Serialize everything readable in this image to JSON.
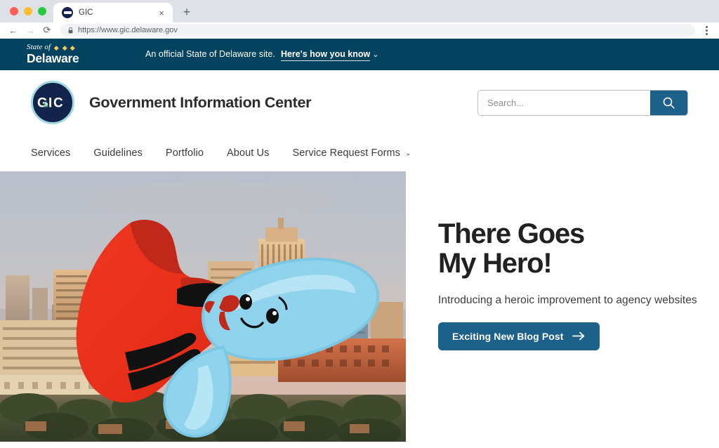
{
  "browser": {
    "tab": {
      "title": "GIC",
      "favicon_icon": "gic-favicon",
      "close_icon": "×"
    },
    "new_tab_icon": "+",
    "back_icon": "←",
    "forward_icon": "→",
    "reload_icon": "⟳",
    "lock_icon": "lock-icon",
    "url": "https://www.gic.delaware.gov",
    "menu_icon": "kebab-menu-icon"
  },
  "gov_banner": {
    "state_of": "State of",
    "state_name": "Delaware",
    "dot_color": "#F2C75C",
    "background": "#04435F",
    "notice": "An official State of Delaware site.",
    "link_label": "Here's how you know",
    "chevron_icon": "⌄"
  },
  "site_header": {
    "logo_text": "GIC",
    "logo_ring_color": "#9fd9df",
    "logo_circle_color": "#13244c",
    "logo_arrow_color": "#3ea06b",
    "title": "Government Information Center",
    "search": {
      "placeholder": "Search...",
      "value": "",
      "button_icon": "search-icon",
      "button_color": "#1B6189"
    }
  },
  "nav": {
    "items": [
      {
        "label": "Services",
        "has_chevron": false
      },
      {
        "label": "Guidelines",
        "has_chevron": false
      },
      {
        "label": "Portfolio",
        "has_chevron": false
      },
      {
        "label": "About Us",
        "has_chevron": false
      },
      {
        "label": "Service Request Forms",
        "has_chevron": true
      }
    ],
    "chevron_icon": "⌄"
  },
  "hero": {
    "image_alt": "Cartoon superhero character with red cape flying over a city skyline at dusk",
    "title": "There Goes\nMy Hero!",
    "subtitle": "Introducing a heroic improvement to agency websites",
    "cta_label": "Exciting New Blog Post",
    "cta_arrow_icon": "arrow-right-icon",
    "cta_color": "#1B6189"
  }
}
